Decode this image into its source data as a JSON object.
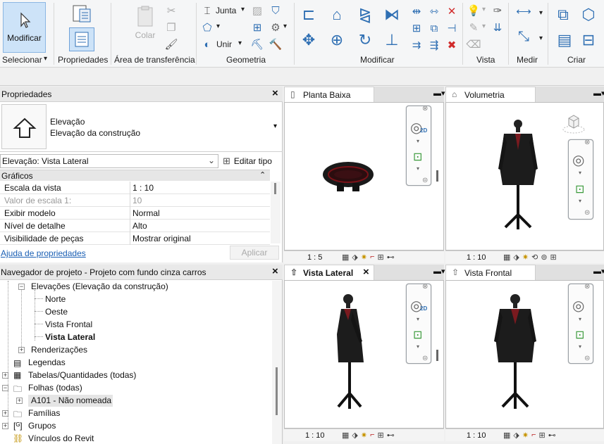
{
  "ribbon": {
    "modificar_label": "Modificar",
    "groups": {
      "selecionar": "Selecionar",
      "propriedades": "Propriedades",
      "area_transferencia": "Área de transferência",
      "geometria": "Geometria",
      "modificar": "Modificar",
      "vista": "Vista",
      "medir": "Medir",
      "criar": "Criar"
    },
    "colar_label": "Colar",
    "junta_label": "Junta",
    "unir_label": "Unir"
  },
  "properties": {
    "title": "Propriedades",
    "type_line1": "Elevação",
    "type_line2": "Elevação da construção",
    "selector_value": "Elevação: Vista Lateral",
    "edit_type_label": "Editar tipo",
    "section_label": "Gráficos",
    "rows": [
      {
        "name": "Escala da vista",
        "value": "1 : 10",
        "muted": false
      },
      {
        "name": "Valor de escala    1:",
        "value": "10",
        "muted": true
      },
      {
        "name": "Exibir modelo",
        "value": "Normal",
        "muted": false
      },
      {
        "name": "Nível de detalhe",
        "value": "Alto",
        "muted": false
      },
      {
        "name": "Visibilidade de peças",
        "value": "Mostrar original",
        "muted": false
      }
    ],
    "help_link": "Ajuda de propriedades",
    "apply_label": "Aplicar"
  },
  "browser": {
    "title": "Navegador de projeto - Projeto com fundo cinza carros",
    "items": [
      {
        "label": "Elevações (Elevação da construção)",
        "bold": false
      },
      {
        "label": "Norte",
        "bold": false
      },
      {
        "label": "Oeste",
        "bold": false
      },
      {
        "label": "Vista Frontal",
        "bold": false
      },
      {
        "label": "Vista Lateral",
        "bold": true
      },
      {
        "label": "Renderizações",
        "bold": false
      },
      {
        "label": "Legendas",
        "bold": false
      },
      {
        "label": "Tabelas/Quantidades (todas)",
        "bold": false
      },
      {
        "label": "Folhas (todas)",
        "bold": false
      },
      {
        "label": "A101 - Não nomeada",
        "bold": false
      },
      {
        "label": "Famílias",
        "bold": false
      },
      {
        "label": "Grupos",
        "bold": false
      },
      {
        "label": "Vínculos do Revit",
        "bold": false
      }
    ]
  },
  "views": {
    "planta": {
      "title": "Planta Baixa",
      "scale": "1 : 5"
    },
    "volumetria": {
      "title": "Volumetria",
      "scale": "1 : 10"
    },
    "lateral": {
      "title": "Vista Lateral",
      "scale": "1 : 10"
    },
    "frontal": {
      "title": "Vista Frontal",
      "scale": "1 : 10"
    }
  },
  "icons": {
    "close": "×",
    "dropdown": "▾",
    "collapse": "»"
  },
  "colors": {
    "accent": "#2f6fb3",
    "select_bg": "#cfe3f7",
    "link": "#1a5fb4"
  }
}
